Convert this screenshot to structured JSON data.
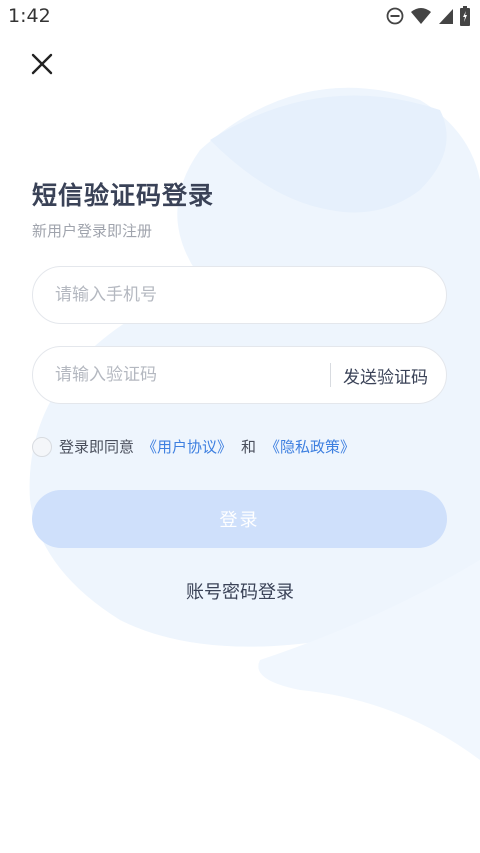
{
  "status_bar": {
    "time": "1:42",
    "icons": [
      "do-not-disturb-icon",
      "wifi-icon",
      "signal-icon",
      "battery-charging-icon"
    ]
  },
  "header": {
    "close_icon": "close-icon"
  },
  "main": {
    "title": "短信验证码登录",
    "subtitle": "新用户登录即注册",
    "phone_input": {
      "value": "",
      "placeholder": "请输入手机号"
    },
    "code_input": {
      "value": "",
      "placeholder": "请输入验证码"
    },
    "send_code_label": "发送验证码",
    "agreement": {
      "prefix": "登录即同意",
      "user_agreement": "《用户协议》",
      "conjunction": "和",
      "privacy_policy": "《隐私政策》"
    },
    "login_label": "登录",
    "password_login_label": "账号密码登录"
  },
  "colors": {
    "accent": "#3d7fe0",
    "login_button_disabled": "#cfe0fb",
    "title_text": "#3a4257",
    "background_decoration": "#eef5fd"
  }
}
